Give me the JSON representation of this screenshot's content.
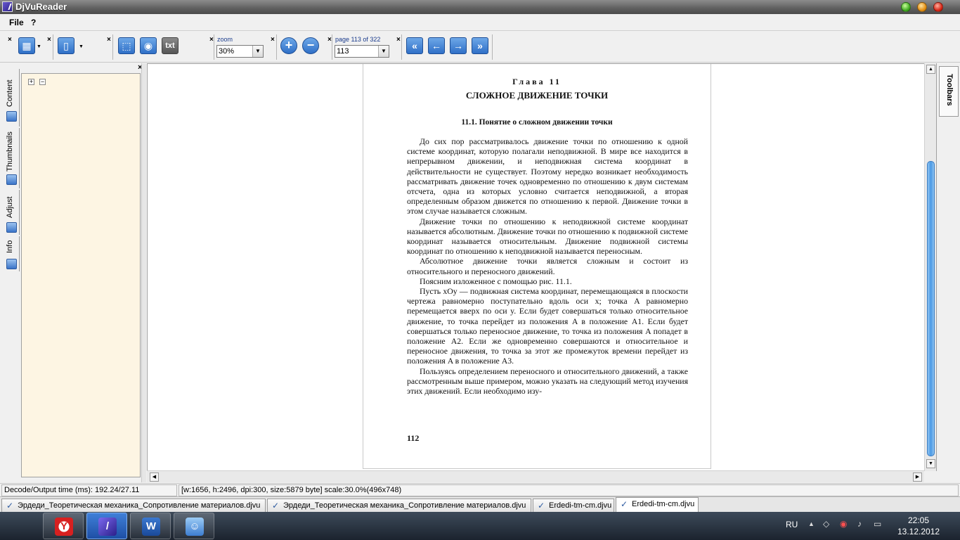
{
  "window": {
    "title": "DjVuReader"
  },
  "menu": {
    "file": "File",
    "help": "?"
  },
  "toolbar": {
    "zoom_label": "zoom",
    "zoom_value": "30%",
    "page_label": "page 113 of 322",
    "page_value": "113",
    "txt_label": "txt"
  },
  "sidebar": {
    "tabs": [
      {
        "label": "Content"
      },
      {
        "label": "Thumbnails"
      },
      {
        "label": "Adjust"
      },
      {
        "label": "Info"
      }
    ]
  },
  "page": {
    "chapter": "Глава 11",
    "title": "СЛОЖНОЕ ДВИЖЕНИЕ ТОЧКИ",
    "section": "11.1. Понятие о сложном движении точки",
    "paragraphs": [
      "До сих пор рассматривалось движение точки по отношению к одной системе координат, которую полагали неподвижной. В мире все находится в непрерывном движении, и неподвижная система координат в действительности не существует. Поэтому нередко возникает необходимость рассматривать движение точек одновременно по отношению к двум системам отсчета, одна из которых условно считается неподвижной, а вторая определенным образом движется по отношению к первой. Движение точки в этом случае называется сложным.",
      "Движение точки по отношению к неподвижной системе координат называется абсолютным. Движение точки по отношению к подвижной системе координат называется относительным. Движение подвижной системы координат по отношению к неподвижной называется переносным.",
      "Абсолютное движение точки является сложным и состоит из относительного и переносного движений.",
      "Поясним изложенное с помощью рис. 11.1.",
      "Пусть xOy — подвижная система координат, перемещающаяся в плоскости чертежа равномерно поступательно вдоль оси x; точка A равномерно перемещается вверх по оси y. Если будет совершаться только относительное движение, то точка перейдет из положения A в положение A1. Если будет совершаться только переносное движение, то точка из положения A попадет в положение A2. Если же одновременно совершаются и относительное и переносное движения, то точка за этот же промежуток времени перейдет из положения A в положение A3.",
      "Пользуясь определением переносного и относительного движений, а также рассмотренным выше примером, можно указать на следующий метод изучения этих движений. Если необходимо изу-"
    ],
    "page_number": "112"
  },
  "right_panel": {
    "label": "Toolbars"
  },
  "status": {
    "decode": "Decode/Output time (ms): 192.24/27.11",
    "info": "[w:1656, h:2496, dpi:300, size:5879 byte] scale:30.0%(496x748)"
  },
  "doc_tabs": [
    {
      "label": "Эрдеди_Теоретическая механика_Сопротивление материалов.djvu"
    },
    {
      "label": "Эрдеди_Теоретическая механика_Сопротивление материалов.djvu"
    },
    {
      "label": "Erdedi-tm-cm.djvu"
    },
    {
      "label": "Erdedi-tm-cm.djvu"
    }
  ],
  "taskbar": {
    "lang": "RU",
    "time": "22:05",
    "date": "13.12.2012"
  },
  "colors": {
    "accent": "#2f6fc7",
    "panel_bg": "#fdf5e3",
    "scroll_thumb": "#4a99e4"
  }
}
